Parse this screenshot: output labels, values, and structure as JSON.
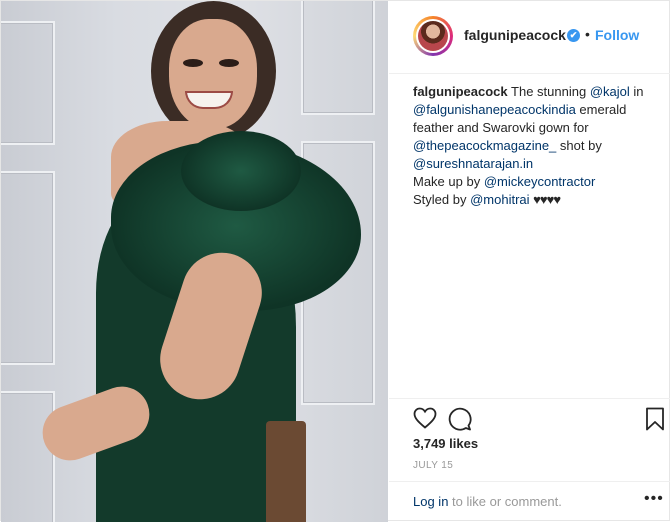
{
  "post": {
    "username": "falgunipeacock",
    "follow_label": "Follow",
    "separator": "•",
    "verified_glyph": "✔"
  },
  "caption": {
    "user": "falgunipeacock",
    "text_1": "The stunning ",
    "mention_1": "@kajol",
    "text_2": " in ",
    "mention_2": "@falgunishanepeacockindia",
    "text_3": " emerald feather and Swarovki gown for ",
    "mention_3": "@thepeacockmagazine_",
    "text_4": " shot by ",
    "mention_4": "@sureshnatarajan.in",
    "line_makeup": "Make up by ",
    "mention_5": "@mickeycontractor",
    "line_styled": "Styled by ",
    "mention_6": "@mohitrai",
    "hearts": "♥♥♥♥"
  },
  "stats": {
    "likes": "3,749 likes",
    "date": "JULY 15"
  },
  "footer": {
    "login_link": "Log in",
    "login_rest": " to like or comment.",
    "more": "•••"
  },
  "icons": {
    "like": "heart-icon",
    "comment": "comment-icon",
    "save": "bookmark-icon",
    "verified": "verified-badge-icon",
    "more": "more-options-icon"
  },
  "colors": {
    "follow": "#3897f0",
    "mention": "#003569",
    "dress": "#133a2b"
  }
}
